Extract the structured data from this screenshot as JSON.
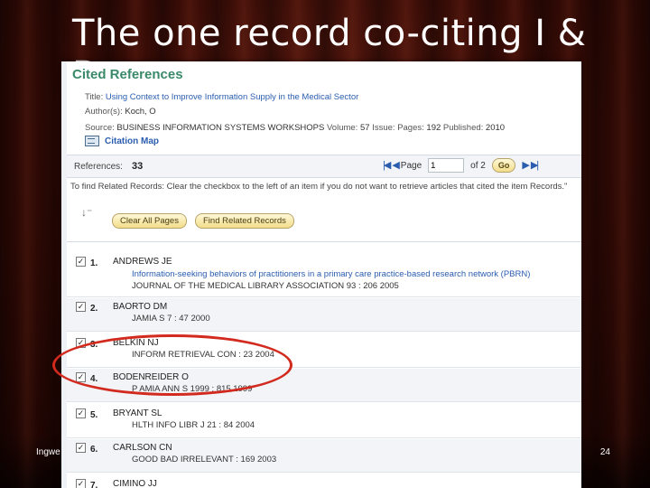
{
  "slide": {
    "title": "The one record co-citing I & B",
    "footer_left": "Ingwe",
    "page_number": "24"
  },
  "panel": {
    "heading": "Cited References",
    "title_label": "Title:",
    "title_value": "Using Context to Improve Information Supply in the Medical Sector",
    "authors_label": "Author(s):",
    "authors_value": "Koch, O",
    "source_label": "Source:",
    "source_value": "BUSINESS INFORMATION SYSTEMS WORKSHOPS",
    "volume_label": "Volume:",
    "volume_value": "57",
    "issue_label": "Issue:",
    "pages_label": "Pages:",
    "pages_value": "192",
    "published_label": "Published:",
    "published_value": "2010",
    "citation_map": "Citation Map",
    "references_label": "References:",
    "references_count": "33",
    "page_label": "Page",
    "page_value": "1",
    "of_label": "of 2",
    "go_label": "Go",
    "instructions": "To find Related Records: Clear the checkbox to the left of an item if you do not want to retrieve articles that cited the item Records.\"",
    "clear_all_label": "Clear All Pages",
    "find_related_label": "Find Related Records",
    "records": [
      {
        "num": "1.",
        "author": "ANDREWS JE",
        "line1": "Information-seeking behaviors of practitioners in a primary care practice-based research network (PBRN)",
        "line2": "JOURNAL OF THE MEDICAL LIBRARY ASSOCIATION 93 : 206 2005"
      },
      {
        "num": "2.",
        "author": "BAORTO DM",
        "line1": "JAMIA S 7 : 47 2000",
        "line2": ""
      },
      {
        "num": "3.",
        "author": "BELKIN NJ",
        "line1": "INFORM RETRIEVAL CON : 23 2004",
        "line2": ""
      },
      {
        "num": "4.",
        "author": "BODENREIDER O",
        "line1": "P AMIA ANN S 1999 : 815 1999",
        "line2": ""
      },
      {
        "num": "5.",
        "author": "BRYANT SL",
        "line1": "HLTH INFO LIBR J 21 : 84 2004",
        "line2": ""
      },
      {
        "num": "6.",
        "author": "CARLSON CN",
        "line1": "GOOD BAD IRRELEVANT : 169 2003",
        "line2": ""
      },
      {
        "num": "7.",
        "author": "CIMINO JJ",
        "line1": "",
        "line2": ""
      }
    ]
  },
  "colors": {
    "accent_green": "#3a8a6a",
    "link_blue": "#2a5db0",
    "highlight_red": "#d22a1e"
  }
}
